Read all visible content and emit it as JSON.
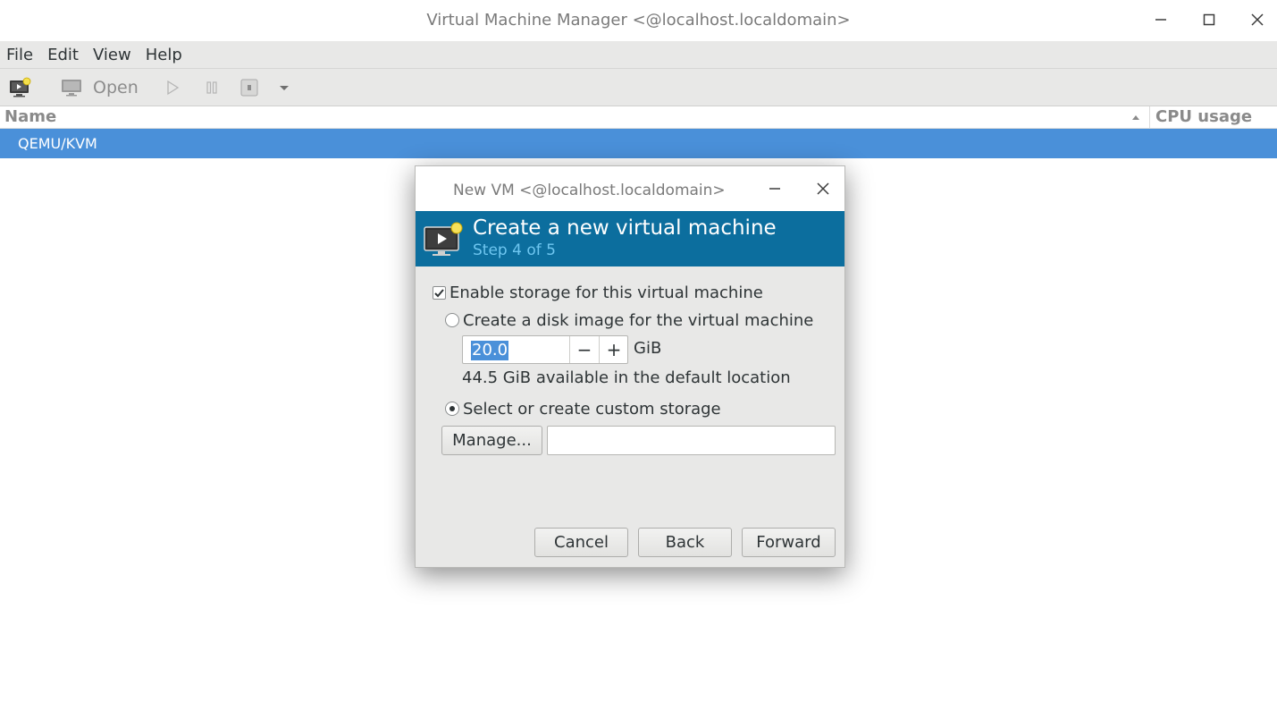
{
  "window": {
    "title": "Virtual Machine Manager <@localhost.localdomain>"
  },
  "menubar": {
    "items": [
      "File",
      "Edit",
      "View",
      "Help"
    ]
  },
  "toolbar": {
    "open_label": "Open"
  },
  "list": {
    "columns": {
      "name": "Name",
      "cpu": "CPU usage"
    },
    "rows": [
      {
        "name": "QEMU/KVM",
        "selected": true
      }
    ]
  },
  "dialog": {
    "title": "New VM <@localhost.localdomain>",
    "banner_title": "Create a new virtual machine",
    "banner_step": "Step 4 of 5",
    "enable_storage": {
      "label": "Enable storage for this virtual machine",
      "checked": true
    },
    "create_disk": {
      "label": "Create a disk image for the virtual machine",
      "selected": false
    },
    "disk_size": {
      "value": "20.0",
      "unit": "GiB",
      "minus": "−",
      "plus": "+"
    },
    "available_text": "44.5 GiB available in the default location",
    "custom_storage": {
      "label": "Select or create custom storage",
      "selected": true
    },
    "manage_label": "Manage...",
    "custom_path_value": "",
    "buttons": {
      "cancel": "Cancel",
      "back": "Back",
      "forward": "Forward"
    }
  },
  "colors": {
    "selection": "#4a90d9",
    "banner": "#0c6e9e",
    "step_text": "#6ec6f0"
  }
}
